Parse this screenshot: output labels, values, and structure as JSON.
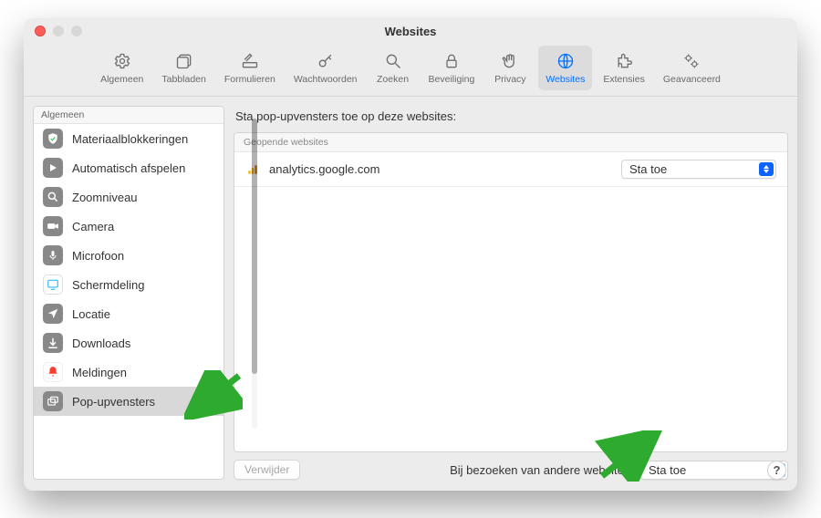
{
  "window": {
    "title": "Websites"
  },
  "toolbar": {
    "items": [
      {
        "label": "Algemeen"
      },
      {
        "label": "Tabbladen"
      },
      {
        "label": "Formulieren"
      },
      {
        "label": "Wachtwoorden"
      },
      {
        "label": "Zoeken"
      },
      {
        "label": "Beveiliging"
      },
      {
        "label": "Privacy"
      },
      {
        "label": "Websites"
      },
      {
        "label": "Extensies"
      },
      {
        "label": "Geavanceerd"
      }
    ]
  },
  "sidebar": {
    "header": "Algemeen",
    "items": [
      {
        "label": "Materiaalblokkeringen"
      },
      {
        "label": "Automatisch afspelen"
      },
      {
        "label": "Zoomniveau"
      },
      {
        "label": "Camera"
      },
      {
        "label": "Microfoon"
      },
      {
        "label": "Schermdeling"
      },
      {
        "label": "Locatie"
      },
      {
        "label": "Downloads"
      },
      {
        "label": "Meldingen"
      },
      {
        "label": "Pop-upvensters"
      }
    ]
  },
  "main": {
    "heading": "Sta pop-upvensters toe op deze websites:",
    "section_label": "Geopende websites",
    "rows": [
      {
        "site": "analytics.google.com",
        "value": "Sta toe"
      }
    ],
    "remove_label": "Verwijder",
    "footer_label": "Bij bezoeken van andere websites:",
    "footer_value": "Sta toe"
  },
  "help": "?"
}
